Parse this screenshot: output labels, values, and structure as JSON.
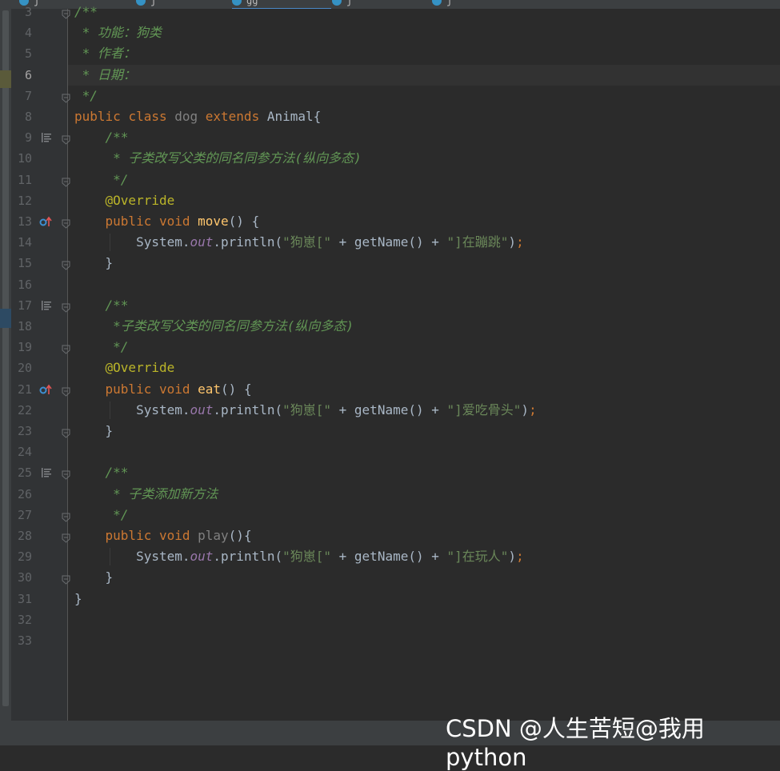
{
  "tabs": [
    {
      "label": "j"
    },
    {
      "label": "j"
    },
    {
      "label": "gg"
    },
    {
      "label": "j"
    },
    {
      "label": "j"
    }
  ],
  "editor": {
    "current_line": "6",
    "lines": [
      {
        "n": "3",
        "tokens": [
          {
            "t": "cm",
            "v": "/**"
          }
        ]
      },
      {
        "n": "4",
        "tokens": [
          {
            "t": "cm",
            "v": " * 功能：狗类"
          }
        ]
      },
      {
        "n": "5",
        "tokens": [
          {
            "t": "cm",
            "v": " * 作者："
          }
        ]
      },
      {
        "n": "6",
        "tokens": [
          {
            "t": "cm",
            "v": " * 日期："
          }
        ]
      },
      {
        "n": "7",
        "tokens": [
          {
            "t": "cm",
            "v": " */"
          }
        ]
      },
      {
        "n": "8",
        "tokens": [
          {
            "t": "kw",
            "v": "public "
          },
          {
            "t": "kw",
            "v": "class "
          },
          {
            "t": "df",
            "v": "dog "
          },
          {
            "t": "kw",
            "v": "extends "
          },
          {
            "t": "pl",
            "v": "Animal{"
          }
        ]
      },
      {
        "n": "9",
        "tokens": [
          {
            "t": "cm",
            "v": "    /**"
          }
        ]
      },
      {
        "n": "10",
        "tokens": [
          {
            "t": "cm",
            "v": "     * 子类改写父类的同名同参方法(纵向多态)"
          }
        ]
      },
      {
        "n": "11",
        "tokens": [
          {
            "t": "cm",
            "v": "     */"
          }
        ]
      },
      {
        "n": "12",
        "tokens": [
          {
            "t": "ann",
            "v": "    @Override"
          }
        ]
      },
      {
        "n": "13",
        "tokens": [
          {
            "t": "kw",
            "v": "    public "
          },
          {
            "t": "kw",
            "v": "void "
          },
          {
            "t": "fn",
            "v": "move"
          },
          {
            "t": "pl",
            "v": "() {"
          }
        ]
      },
      {
        "n": "14",
        "tokens": [
          {
            "t": "pl",
            "v": "        System."
          },
          {
            "t": "fld",
            "v": "out"
          },
          {
            "t": "pl",
            "v": ".println("
          },
          {
            "t": "st",
            "v": "\"狗崽[\""
          },
          {
            "t": "pl",
            "v": " + getName() + "
          },
          {
            "t": "st",
            "v": "\"]在蹦跳\""
          },
          {
            "t": "pl",
            "v": ")"
          },
          {
            "t": "kw",
            "v": ";"
          }
        ]
      },
      {
        "n": "15",
        "tokens": [
          {
            "t": "pl",
            "v": "    }"
          }
        ]
      },
      {
        "n": "16",
        "tokens": []
      },
      {
        "n": "17",
        "tokens": [
          {
            "t": "cm",
            "v": "    /**"
          }
        ]
      },
      {
        "n": "18",
        "tokens": [
          {
            "t": "cm",
            "v": "     *子类改写父类的同名同参方法(纵向多态)"
          }
        ]
      },
      {
        "n": "19",
        "tokens": [
          {
            "t": "cm",
            "v": "     */"
          }
        ]
      },
      {
        "n": "20",
        "tokens": [
          {
            "t": "ann",
            "v": "    @Override"
          }
        ]
      },
      {
        "n": "21",
        "tokens": [
          {
            "t": "kw",
            "v": "    public "
          },
          {
            "t": "kw",
            "v": "void "
          },
          {
            "t": "fn",
            "v": "eat"
          },
          {
            "t": "pl",
            "v": "() {"
          }
        ]
      },
      {
        "n": "22",
        "tokens": [
          {
            "t": "pl",
            "v": "        System."
          },
          {
            "t": "fld",
            "v": "out"
          },
          {
            "t": "pl",
            "v": ".println("
          },
          {
            "t": "st",
            "v": "\"狗崽[\""
          },
          {
            "t": "pl",
            "v": " + getName() + "
          },
          {
            "t": "st",
            "v": "\"]爱吃骨头\""
          },
          {
            "t": "pl",
            "v": ")"
          },
          {
            "t": "kw",
            "v": ";"
          }
        ]
      },
      {
        "n": "23",
        "tokens": [
          {
            "t": "pl",
            "v": "    }"
          }
        ]
      },
      {
        "n": "24",
        "tokens": []
      },
      {
        "n": "25",
        "tokens": [
          {
            "t": "cm",
            "v": "    /**"
          }
        ]
      },
      {
        "n": "26",
        "tokens": [
          {
            "t": "cm",
            "v": "     * 子类添加新方法"
          }
        ]
      },
      {
        "n": "27",
        "tokens": [
          {
            "t": "cm",
            "v": "     */"
          }
        ]
      },
      {
        "n": "28",
        "tokens": [
          {
            "t": "kw",
            "v": "    public "
          },
          {
            "t": "kw",
            "v": "void "
          },
          {
            "t": "df",
            "v": "play"
          },
          {
            "t": "pl",
            "v": "(){"
          }
        ]
      },
      {
        "n": "29",
        "tokens": [
          {
            "t": "pl",
            "v": "        System."
          },
          {
            "t": "fld",
            "v": "out"
          },
          {
            "t": "pl",
            "v": ".println("
          },
          {
            "t": "st",
            "v": "\"狗崽[\""
          },
          {
            "t": "pl",
            "v": " + getName() + "
          },
          {
            "t": "st",
            "v": "\"]在玩人\""
          },
          {
            "t": "pl",
            "v": ")"
          },
          {
            "t": "kw",
            "v": ";"
          }
        ]
      },
      {
        "n": "30",
        "tokens": [
          {
            "t": "pl",
            "v": "    }"
          }
        ]
      },
      {
        "n": "31",
        "tokens": [
          {
            "t": "pl",
            "v": "}"
          }
        ]
      },
      {
        "n": "32",
        "tokens": []
      },
      {
        "n": "33",
        "tokens": []
      }
    ]
  },
  "gutter_icons": {
    "9": "doc-comment-icon",
    "17": "doc-comment-icon",
    "25": "doc-comment-icon",
    "13": "override-method-icon",
    "21": "override-method-icon"
  },
  "fold_markers": [
    "3",
    "7",
    "9",
    "11",
    "13",
    "15",
    "17",
    "19",
    "21",
    "23",
    "25",
    "27",
    "28",
    "30"
  ],
  "colors": {
    "background": "#2b2b2b",
    "keyword": "#cc7832",
    "comment": "#629755",
    "annotation": "#bbb529",
    "method": "#ffc66d",
    "string": "#6a8759",
    "static_field": "#9876aa"
  },
  "watermark": "CSDN @人生苦短@我用python"
}
